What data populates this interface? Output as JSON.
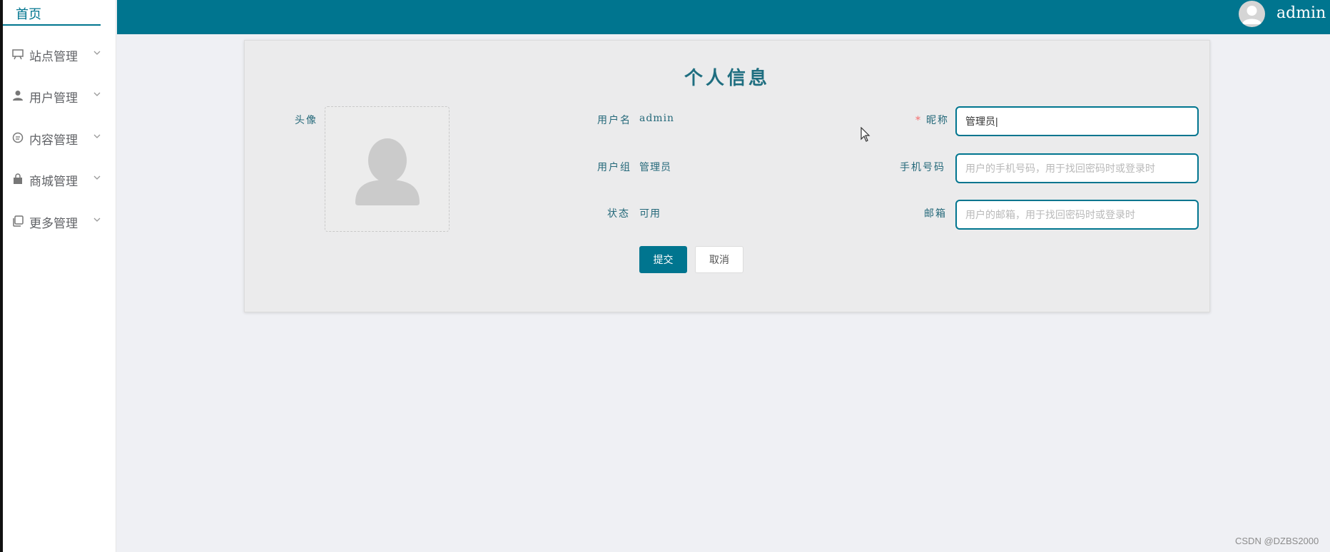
{
  "sidebar": {
    "home_label": "首页",
    "items": [
      {
        "label": "站点管理",
        "icon": "monitor-icon"
      },
      {
        "label": "用户管理",
        "icon": "user-icon"
      },
      {
        "label": "内容管理",
        "icon": "chat-icon"
      },
      {
        "label": "商城管理",
        "icon": "bag-icon"
      },
      {
        "label": "更多管理",
        "icon": "copy-icon"
      }
    ]
  },
  "header": {
    "username": "admin",
    "color": "#00758f"
  },
  "profile": {
    "title": "个人信息",
    "avatar_label": "头像",
    "username_label": "用户名",
    "username_value": "admin",
    "group_label": "用户组",
    "group_value": "管理员",
    "status_label": "状态",
    "status_value": "可用",
    "nickname_required": "*",
    "nickname_label": "昵称",
    "nickname_value": "管理员|",
    "phone_label": "手机号码",
    "phone_placeholder": "用户的手机号码，用于找回密码时或登录时",
    "email_label": "邮箱",
    "email_placeholder": "用户的邮箱，用于找回密码时或登录时",
    "submit_label": "提交",
    "cancel_label": "取消"
  },
  "watermark": "CSDN @DZBS2000"
}
